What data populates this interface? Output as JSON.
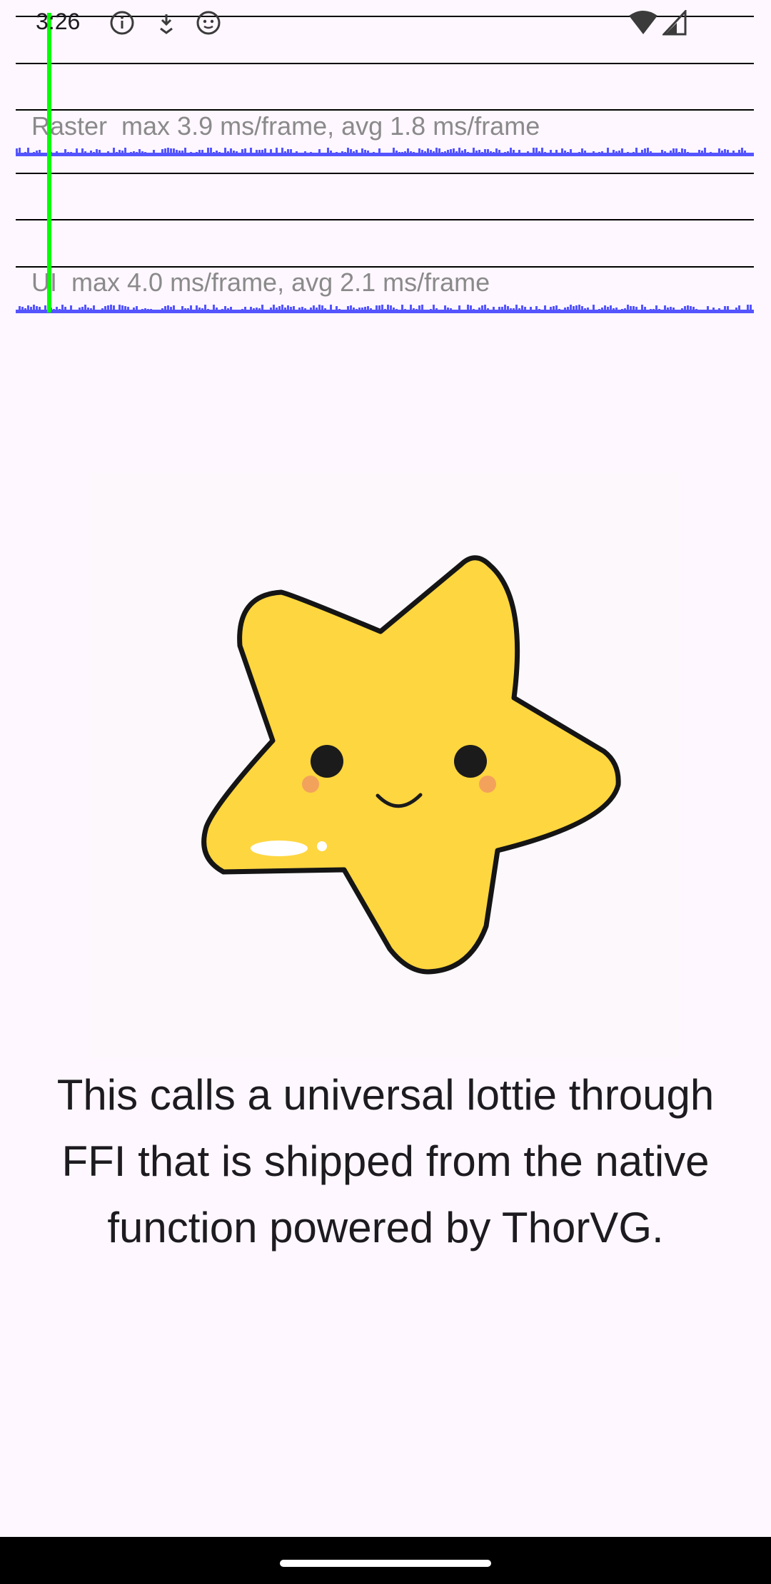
{
  "status_bar": {
    "time": "3:26",
    "left_icons": [
      "info-icon",
      "download-icon",
      "notification-icon"
    ],
    "right_icons": [
      "wifi-icon",
      "signal-icon"
    ]
  },
  "performance_overlay": {
    "raster_label": "Raster  max 3.9 ms/frame, avg 1.8 ms/frame",
    "ui_label": "UI  max 4.0 ms/frame, avg 2.1 ms/frame",
    "colors": {
      "bars": "#5555ff",
      "marker": "#00ff00",
      "gridlines": "#000000"
    }
  },
  "main": {
    "image": "star-lottie-animation",
    "caption": "This calls a universal lottie through FFI that is shipped from the native function powered by ThorVG."
  },
  "nav_bar": {
    "handle": "home-handle"
  }
}
